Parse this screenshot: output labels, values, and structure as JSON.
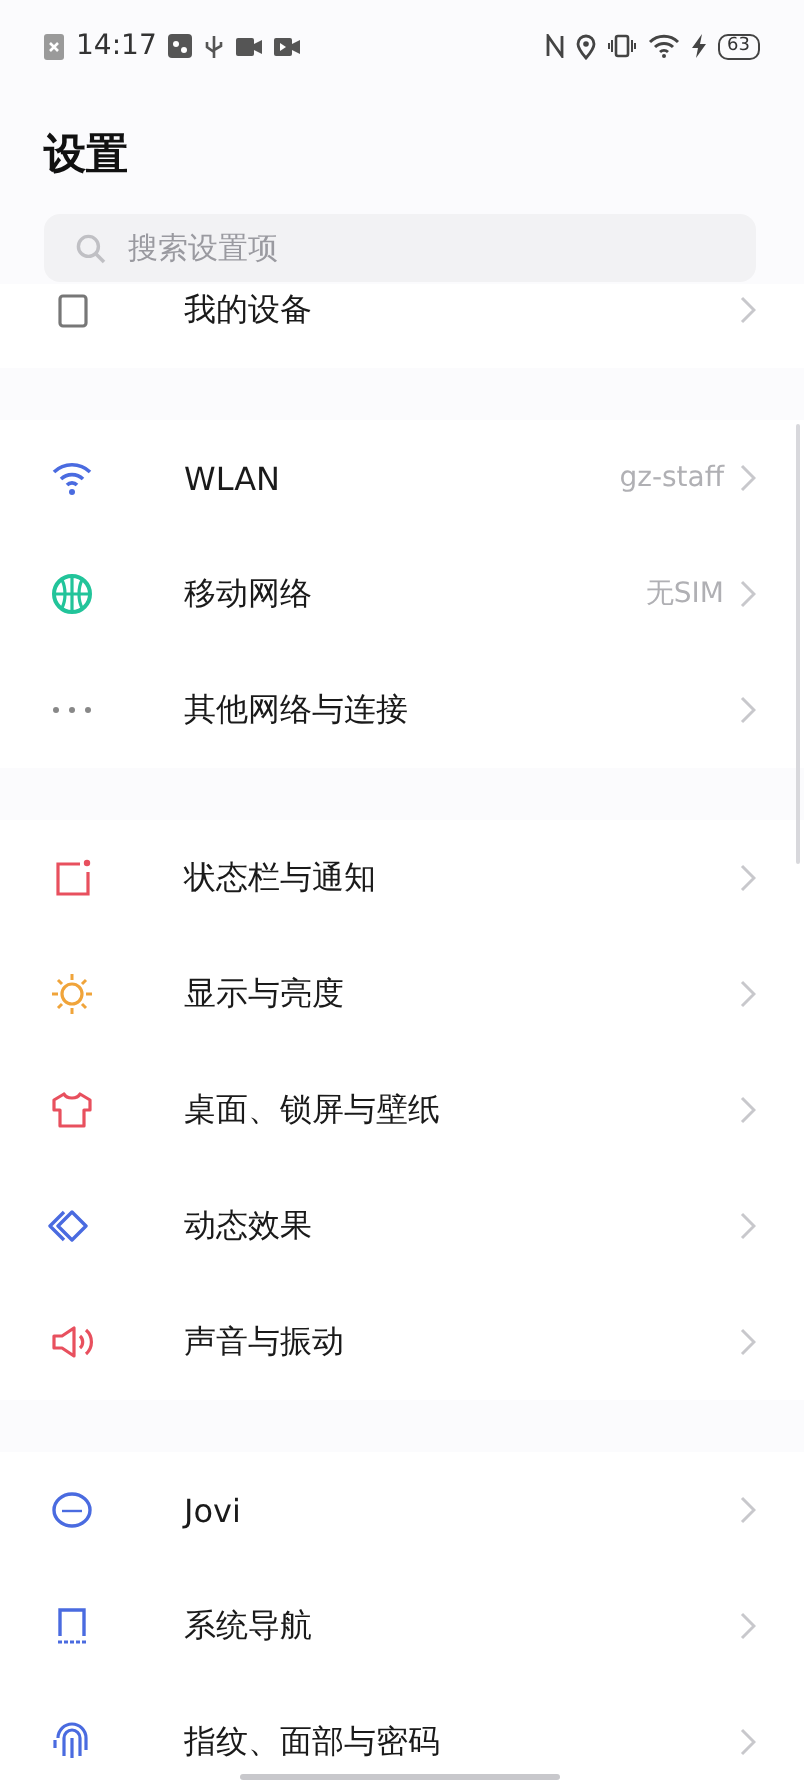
{
  "status_bar": {
    "time": "14:17",
    "battery": "63"
  },
  "title": "设置",
  "search": {
    "placeholder": "搜索设置项"
  },
  "groups": [
    {
      "items": [
        {
          "label": "我的设备"
        }
      ]
    },
    {
      "items": [
        {
          "label": "WLAN",
          "value": "gz-staff"
        },
        {
          "label": "移动网络",
          "value": "无SIM"
        },
        {
          "label": "其他网络与连接"
        }
      ]
    },
    {
      "items": [
        {
          "label": "状态栏与通知"
        },
        {
          "label": "显示与亮度"
        },
        {
          "label": "桌面、锁屏与壁纸"
        },
        {
          "label": "动态效果"
        },
        {
          "label": "声音与振动"
        }
      ]
    },
    {
      "items": [
        {
          "label": "Jovi"
        },
        {
          "label": "系统导航"
        },
        {
          "label": "指纹、面部与密码"
        }
      ]
    }
  ]
}
